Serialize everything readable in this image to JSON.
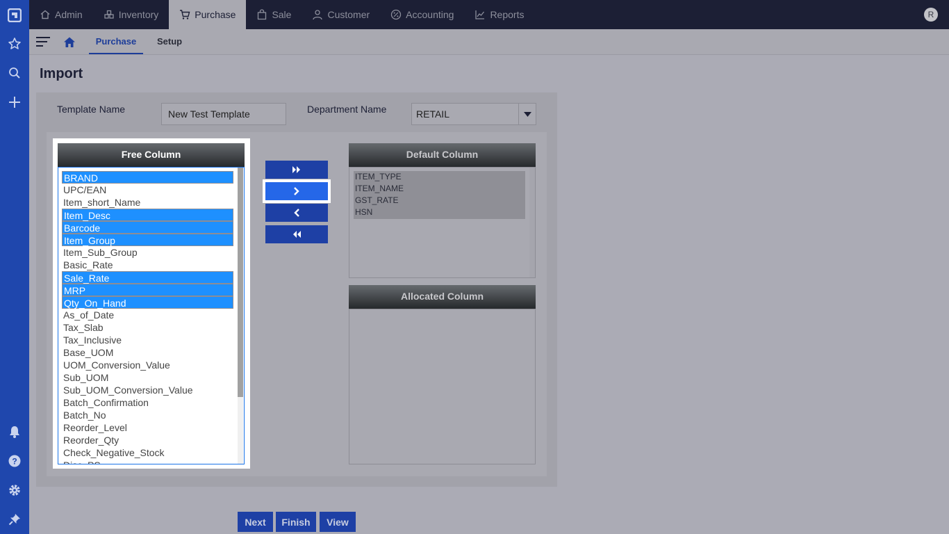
{
  "topnav": {
    "items": [
      {
        "label": "Admin",
        "icon": "home-icon"
      },
      {
        "label": "Inventory",
        "icon": "inventory-icon"
      },
      {
        "label": "Purchase",
        "icon": "cart-icon"
      },
      {
        "label": "Sale",
        "icon": "bag-icon"
      },
      {
        "label": "Customer",
        "icon": "person-icon"
      },
      {
        "label": "Accounting",
        "icon": "percent-icon"
      },
      {
        "label": "Reports",
        "icon": "chart-icon"
      }
    ],
    "active": "Purchase",
    "avatar_initial": "R"
  },
  "subnav": {
    "tabs": [
      {
        "label": "Purchase"
      },
      {
        "label": "Setup"
      }
    ],
    "active": "Purchase"
  },
  "page": {
    "title": "Import",
    "template_name_label": "Template Name",
    "template_name_value": "New Test Template",
    "department_label": "Department Name",
    "department_value": "RETAIL"
  },
  "free_column": {
    "header": "Free Column",
    "items": [
      {
        "label": "BRAND",
        "selected": true
      },
      {
        "label": "UPC/EAN",
        "selected": false
      },
      {
        "label": "Item_short_Name",
        "selected": false
      },
      {
        "label": "Item_Desc",
        "selected": true
      },
      {
        "label": "Barcode",
        "selected": true
      },
      {
        "label": "Item_Group",
        "selected": true
      },
      {
        "label": "Item_Sub_Group",
        "selected": false
      },
      {
        "label": "Basic_Rate",
        "selected": false
      },
      {
        "label": "Sale_Rate",
        "selected": true
      },
      {
        "label": "MRP",
        "selected": true
      },
      {
        "label": "Qty_On_Hand",
        "selected": true
      },
      {
        "label": "As_of_Date",
        "selected": false
      },
      {
        "label": "Tax_Slab",
        "selected": false
      },
      {
        "label": "Tax_Inclusive",
        "selected": false
      },
      {
        "label": "Base_UOM",
        "selected": false
      },
      {
        "label": "UOM_Conversion_Value",
        "selected": false
      },
      {
        "label": "Sub_UOM",
        "selected": false
      },
      {
        "label": "Sub_UOM_Conversion_Value",
        "selected": false
      },
      {
        "label": "Batch_Confirmation",
        "selected": false
      },
      {
        "label": "Batch_No",
        "selected": false
      },
      {
        "label": "Reorder_Level",
        "selected": false
      },
      {
        "label": "Reorder_Qty",
        "selected": false
      },
      {
        "label": "Check_Negative_Stock",
        "selected": false
      },
      {
        "label": "Disc_PS",
        "selected": false
      }
    ]
  },
  "default_column": {
    "header": "Default Column",
    "items": [
      "ITEM_TYPE",
      "ITEM_NAME",
      "GST_RATE",
      "HSN"
    ]
  },
  "allocated_column": {
    "header": "Allocated Column",
    "items": []
  },
  "transfer_buttons": [
    {
      "icon": "double-chevron-right-icon"
    },
    {
      "icon": "chevron-right-icon",
      "highlighted": true
    },
    {
      "icon": "chevron-left-icon"
    },
    {
      "icon": "double-chevron-left-icon"
    }
  ],
  "actions": {
    "next": "Next",
    "finish": "Finish",
    "view": "View"
  },
  "colors": {
    "rail": "#1f47ad",
    "topbar": "#1c1f35",
    "selection": "#1e90ff",
    "button": "#1e40a5"
  }
}
